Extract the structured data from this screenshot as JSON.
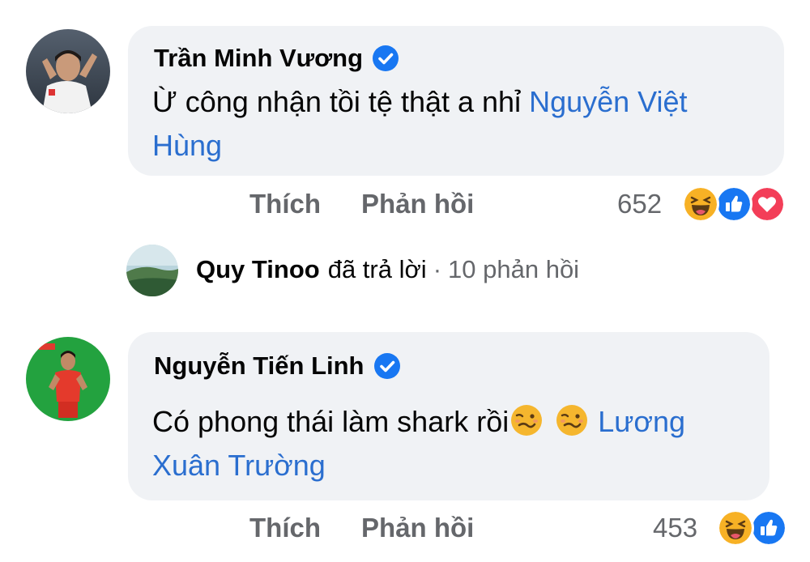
{
  "comments": [
    {
      "author": "Trần Minh Vương",
      "text": "Ừ công nhận tồi tệ thật a nhỉ ",
      "mention_line1": "Nguyễn Việt",
      "mention_line2": "Hùng",
      "actions": {
        "like": "Thích",
        "reply": "Phản hồi"
      },
      "reaction_count": "652",
      "reactions": [
        "haha-icon",
        "like-icon",
        "love-icon"
      ]
    },
    {
      "author": "Nguyễn Tiến Linh",
      "text": "Có phong thái làm shark rồi",
      "mention_line1": "Lương",
      "mention_line2": "Xuân Trường",
      "actions": {
        "like": "Thích",
        "reply": "Phản hồi"
      },
      "reaction_count": "453",
      "reactions": [
        "haha-icon",
        "like-icon"
      ]
    }
  ],
  "reply_summary": {
    "name": "Quy Tinoo",
    "text": "đã trả lời",
    "separator": "·",
    "count": "10 phản hồi"
  },
  "colors": {
    "bubble": "#f0f2f5",
    "mention": "#2a6ecf",
    "muted": "#65676b",
    "verified": "#1877f2",
    "like": "#1877f2",
    "love": "#f33e58",
    "haha": "#f7b125"
  }
}
